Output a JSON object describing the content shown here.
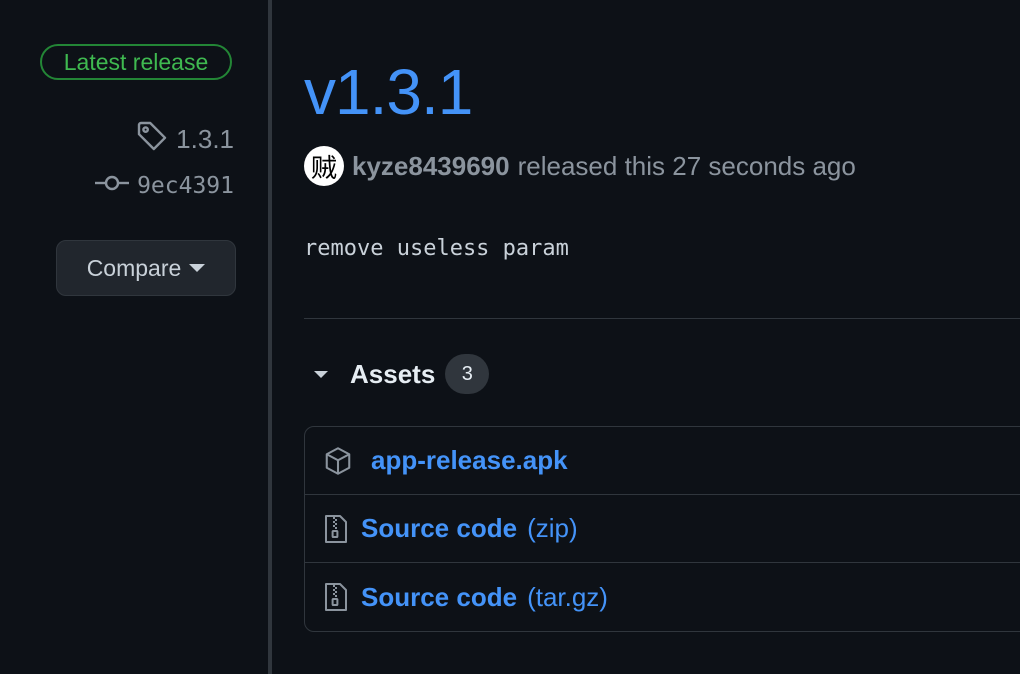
{
  "sidebar": {
    "latest_badge": "Latest release",
    "tag": "1.3.1",
    "commit": "9ec4391",
    "compare_label": "Compare",
    "icons": {
      "tag": "tag-icon",
      "commit": "git-commit-icon",
      "caret": "chevron-down-icon"
    }
  },
  "release": {
    "title": "v1.3.1",
    "avatar_glyph": "贼",
    "author": "kyze8439690",
    "released_text": "released this 27 seconds ago",
    "description": "remove useless param"
  },
  "assets": {
    "label": "Assets",
    "count": "3",
    "items": [
      {
        "name": "app-release.apk",
        "suffix": "",
        "icon": "package-icon"
      },
      {
        "name": "Source code",
        "suffix": "(zip)",
        "icon": "file-zip-icon"
      },
      {
        "name": "Source code",
        "suffix": "(tar.gz)",
        "icon": "file-zip-icon"
      }
    ]
  },
  "colors": {
    "background": "#0d1117",
    "link": "#4493f8",
    "badge_green": "#3fb950",
    "muted": "#8b949e",
    "border": "#30363d"
  }
}
